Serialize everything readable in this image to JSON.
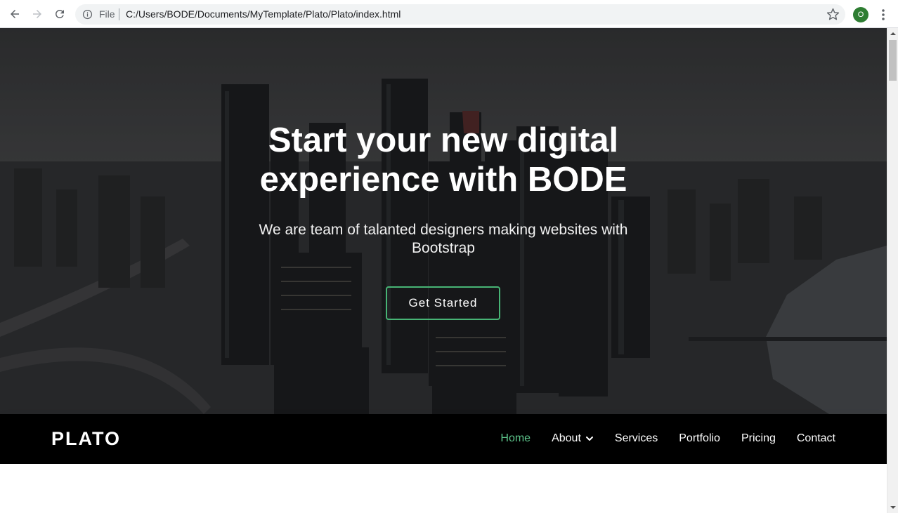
{
  "browser": {
    "file_label": "File",
    "url": "C:/Users/BODE/Documents/MyTemplate/Plato/Plato/index.html",
    "profile_initial": "O"
  },
  "hero": {
    "title": "Start your new digital experience with BODE",
    "subtitle": "We are team of talanted designers making websites with Bootstrap",
    "cta_label": "Get Started"
  },
  "navbar": {
    "brand": "PLATO",
    "links": [
      {
        "label": "Home",
        "active": true
      },
      {
        "label": "About",
        "has_dropdown": true
      },
      {
        "label": "Services"
      },
      {
        "label": "Portfolio"
      },
      {
        "label": "Pricing"
      },
      {
        "label": "Contact"
      }
    ]
  },
  "colors": {
    "accent_green": "#47b475",
    "active_link": "#5cc38a",
    "navbar_bg": "#000000",
    "hero_text": "#ffffff"
  },
  "icons": {
    "back": "back-arrow-icon",
    "forward": "forward-arrow-icon",
    "reload": "reload-icon",
    "info": "info-icon",
    "bookmark": "star-icon",
    "menu": "kebab-menu-icon",
    "dropdown": "chevron-down-icon"
  }
}
